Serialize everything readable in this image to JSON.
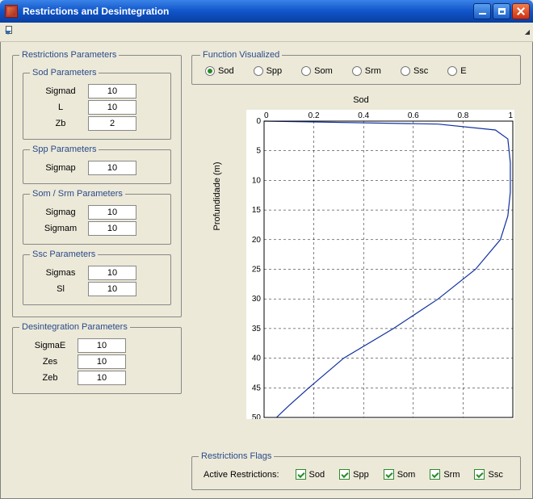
{
  "window": {
    "title": "Restrictions and Desintegration"
  },
  "panels": {
    "restrictions": {
      "title": "Restrictions Parameters"
    },
    "desintegration": {
      "title": "Desintegration Parameters"
    },
    "function_visualized": {
      "title": "Function Visualized"
    },
    "restrictions_flags": {
      "title": "Restrictions Flags"
    }
  },
  "sod_params": {
    "title": "Sod Parameters",
    "sigmad_label": "Sigmad",
    "sigmad_value": "10",
    "l_label": "L",
    "l_value": "10",
    "zb_label": "Zb",
    "zb_value": "2"
  },
  "spp_params": {
    "title": "Spp Parameters",
    "sigmap_label": "Sigmap",
    "sigmap_value": "10"
  },
  "som_srm_params": {
    "title": "Som / Srm Parameters",
    "sigmag_label": "Sigmag",
    "sigmag_value": "10",
    "sigmam_label": "Sigmam",
    "sigmam_value": "10"
  },
  "ssc_params": {
    "title": "Ssc Parameters",
    "sigmas_label": "Sigmas",
    "sigmas_value": "10",
    "sl_label": "Sl",
    "sl_value": "10"
  },
  "desint_params": {
    "sigmae_label": "SigmaE",
    "sigmae_value": "10",
    "zes_label": "Zes",
    "zes_value": "10",
    "zeb_label": "Zeb",
    "zeb_value": "10"
  },
  "function_radios": {
    "sod": "Sod",
    "spp": "Spp",
    "som": "Som",
    "srm": "Srm",
    "ssc": "Ssc",
    "e": "E",
    "selected": "sod"
  },
  "flags": {
    "lead": "Active Restrictions:",
    "sod": "Sod",
    "spp": "Spp",
    "som": "Som",
    "srm": "Srm",
    "ssc": "Ssc"
  },
  "chart_data": {
    "type": "line",
    "title": "Sod",
    "xlabel": "",
    "ylabel": "Profundidade (m)",
    "xlim": [
      0,
      1
    ],
    "ylim": [
      50,
      0
    ],
    "x_ticks": [
      0,
      0.2,
      0.4,
      0.6,
      0.8,
      1
    ],
    "y_ticks": [
      0,
      5,
      10,
      15,
      20,
      25,
      30,
      35,
      40,
      45,
      50
    ],
    "x_tick_labels": [
      "0",
      "0.2",
      "0.4",
      "0.6",
      "0.8",
      "1"
    ],
    "y_tick_labels": [
      "0",
      "5",
      "10",
      "15",
      "20",
      "25",
      "30",
      "35",
      "40",
      "45",
      "50"
    ],
    "series": [
      {
        "name": "Sod",
        "points": [
          {
            "x": 0.0,
            "y": 0.0
          },
          {
            "x": 0.7,
            "y": 0.5
          },
          {
            "x": 0.93,
            "y": 1.5
          },
          {
            "x": 0.98,
            "y": 3.0
          },
          {
            "x": 0.99,
            "y": 7.0
          },
          {
            "x": 0.99,
            "y": 12.0
          },
          {
            "x": 0.98,
            "y": 16.0
          },
          {
            "x": 0.95,
            "y": 20.0
          },
          {
            "x": 0.85,
            "y": 25.0
          },
          {
            "x": 0.7,
            "y": 30.0
          },
          {
            "x": 0.52,
            "y": 35.0
          },
          {
            "x": 0.32,
            "y": 40.0
          },
          {
            "x": 0.18,
            "y": 45.0
          },
          {
            "x": 0.1,
            "y": 48.0
          },
          {
            "x": 0.05,
            "y": 50.0
          }
        ]
      }
    ]
  }
}
